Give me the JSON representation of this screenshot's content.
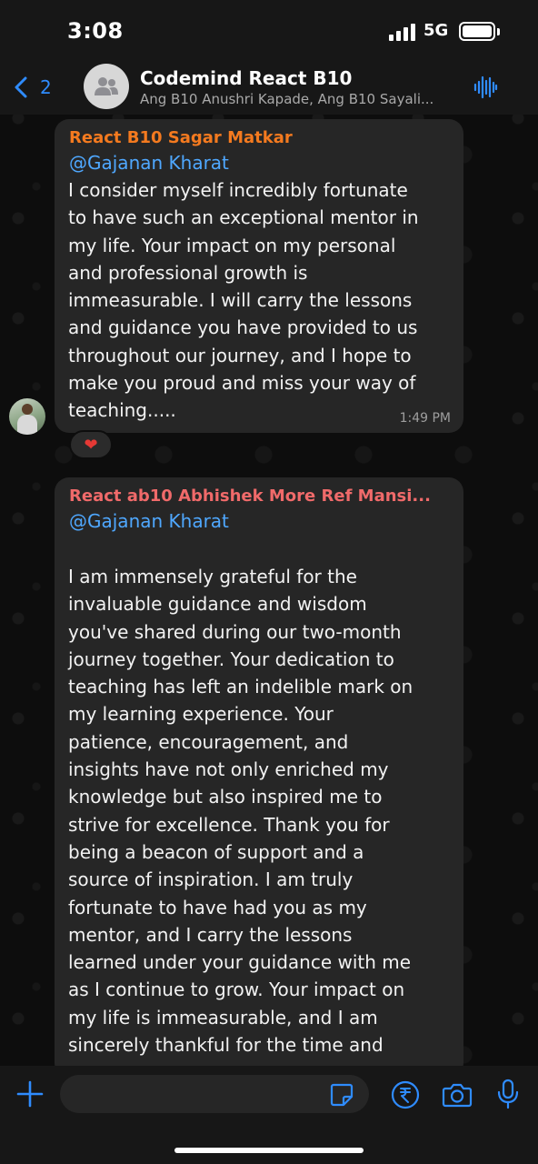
{
  "status_bar": {
    "time": "3:08",
    "network": "5G"
  },
  "header": {
    "back_count": "2",
    "title": "Codemind React B10",
    "subtitle": "Ang B10 Anushri Kapade, Ang B10 Sayali..."
  },
  "messages": [
    {
      "sender": "React B10 Sagar Matkar",
      "mention": "@Gajanan Kharat",
      "text": "I consider myself incredibly fortunate\nto have such an exceptional mentor in\nmy life. Your impact on my personal\nand professional growth is\nimmeasurable. I will carry the lessons\nand guidance you have provided to us\nthroughout our journey, and I hope to\nmake you proud and miss your way of\nteaching.....",
      "time": "1:49 PM",
      "reaction": "❤"
    },
    {
      "sender": "React ab10 Abhishek More Ref Mansi...",
      "mention": "@Gajanan Kharat",
      "text": "I am immensely grateful for the\ninvaluable guidance and wisdom\nyou've shared during our two-month\njourney together. Your dedication to\nteaching has left an indelible mark on\nmy learning experience. Your\npatience, encouragement, and\ninsights have not only enriched my\nknowledge but also inspired me to\nstrive for excellence. Thank you for\nbeing a beacon of support and a\nsource of inspiration. I am truly\nfortunate to have had you as my\nmentor, and I carry the lessons\nlearned under your guidance with me\nas I continue to grow. Your impact on\nmy life is immeasurable, and I am\nsincerely thankful for the time and"
    }
  ],
  "input_bar": {
    "value": "",
    "placeholder": ""
  },
  "colors": {
    "accent": "#2f8cff",
    "sender_1": "#f47a1f",
    "sender_2": "#f06a6a",
    "mention": "#4fa8ff",
    "bubble": "#262626"
  },
  "icons": {
    "back": "chevron-left-icon",
    "group_avatar": "group-people-icon",
    "audio": "audio-waveform-icon",
    "plus": "plus-icon",
    "sticker": "sticker-icon",
    "payment": "rupee-icon",
    "camera": "camera-icon",
    "mic": "microphone-icon"
  }
}
